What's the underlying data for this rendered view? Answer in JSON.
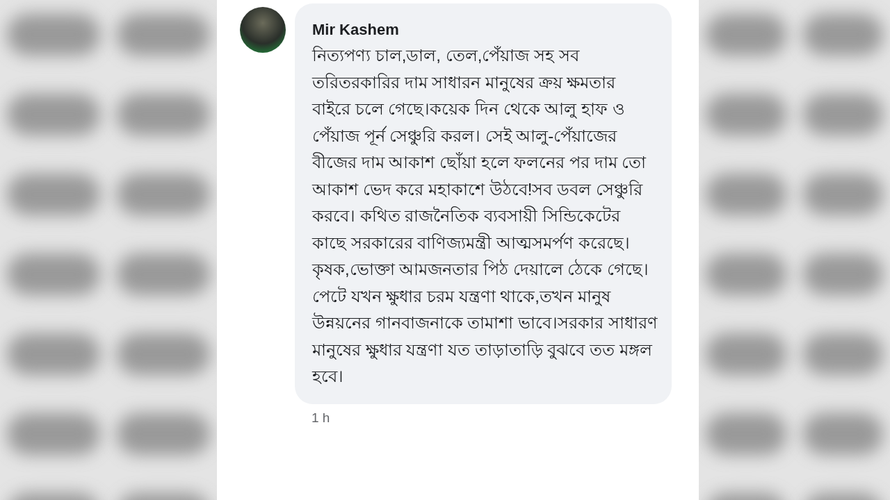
{
  "comment": {
    "author": "Mir Kashem",
    "text": "নিত্যপণ্য চাল,ডাল, তেল,পেঁয়াজ সহ সব তরিতরকারির দাম সাধারন মানুষের ক্রয় ক্ষমতার বাইরে চলে গেছে।কয়েক দিন থেকে আলু হাফ ও পেঁয়াজ পূর্ন সেঞ্চুরি করল। সেই আলু-পেঁয়াজের বীজের দাম আকাশ ছোঁয়া হলে ফলনের পর দাম তো আকাশ ভেদ করে মহাকাশে উঠবে!সব ডবল সেঞ্চুরি করবে। কথিত রাজনৈতিক ব্যবসায়ী সিন্ডিকেটের কাছে সরকারের বাণিজ্যমন্ত্রী আত্মসমর্পণ করেছে। কৃষক,ভোক্তা আমজনতার পিঠ দেয়ালে ঠেকে গেছে। পেটে যখন ক্ষুধার চরম যন্ত্রণা থাকে,তখন মানুষ উন্নয়নের গানবাজনাকে তামাশা ভাবে।সরকার সাধারণ মানুষের ক্ষুধার যন্ত্রণা যত তাড়াতাড়ি বুঝবে তত মঙ্গল হবে।",
    "time": "1 h"
  }
}
